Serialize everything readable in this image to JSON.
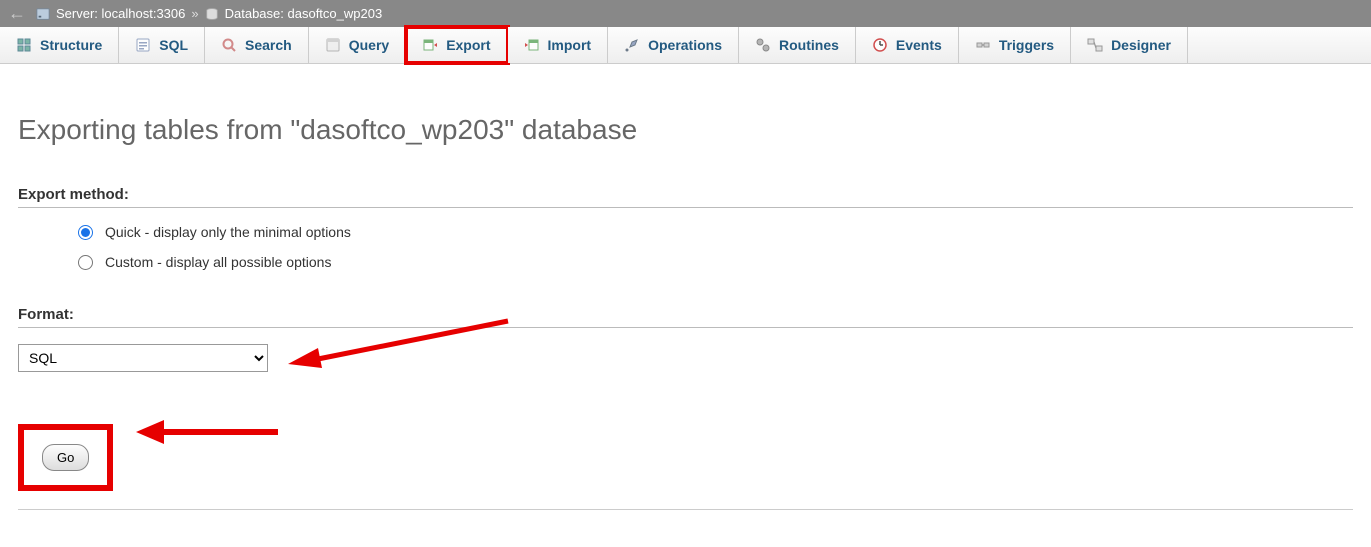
{
  "breadcrumb": {
    "server_label": "Server:",
    "server_value": "localhost:3306",
    "db_label": "Database:",
    "db_value": "dasoftco_wp203"
  },
  "tabs": {
    "structure": "Structure",
    "sql": "SQL",
    "search": "Search",
    "query": "Query",
    "export": "Export",
    "import": "Import",
    "operations": "Operations",
    "routines": "Routines",
    "events": "Events",
    "triggers": "Triggers",
    "designer": "Designer"
  },
  "page_title": "Exporting tables from \"dasoftco_wp203\" database",
  "export_method": {
    "heading": "Export method:",
    "quick": "Quick - display only the minimal options",
    "custom": "Custom - display all possible options"
  },
  "format": {
    "heading": "Format:",
    "selected": "SQL"
  },
  "go_label": "Go"
}
